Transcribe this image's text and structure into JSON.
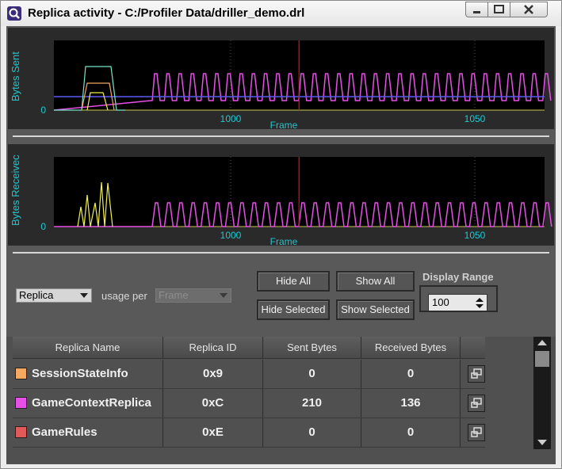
{
  "window": {
    "title": "Replica activity - C:/Profiler Data/driller_demo.drl",
    "buttons": [
      "minimize",
      "maximize",
      "close"
    ]
  },
  "colors": {
    "accent_cyan": "#1ec8d2",
    "frame_marker": "#d01818",
    "series_magenta": "#e650e6",
    "series_yellow": "#f0f050",
    "series_orange": "#f4a860",
    "series_cyan": "#78e6c8",
    "series_blue": "#5a5af0"
  },
  "graphs": {
    "sent": {
      "ylabel": "Bytes Sent",
      "xlabel": "Frame",
      "y_zero": "0",
      "ticks": [
        "1000",
        "1050"
      ]
    },
    "received": {
      "ylabel": "Bytes Receivec",
      "xlabel": "Frame",
      "y_zero": "0",
      "ticks": [
        "1000",
        "1050"
      ]
    }
  },
  "chart_data": [
    {
      "type": "line",
      "title": "",
      "xlabel": "Frame",
      "ylabel": "Bytes Sent",
      "x_ticks": [
        1000,
        1050
      ],
      "current_frame_marker": 1014,
      "series": [
        {
          "name": "GameContextReplica",
          "color": "#e650e6",
          "pattern": "periodic spikes from frame ~980"
        }
      ]
    },
    {
      "type": "line",
      "title": "",
      "xlabel": "Frame",
      "ylabel": "Bytes Receivec",
      "x_ticks": [
        1000,
        1050
      ],
      "current_frame_marker": 1014,
      "series": [
        {
          "name": "GameContextReplica",
          "color": "#e650e6",
          "pattern": "periodic spikes from frame ~980"
        }
      ]
    }
  ],
  "controls": {
    "replica_combo": "Replica",
    "usage_label": "usage per",
    "frame_combo": "Frame",
    "hide_all": "Hide All",
    "show_all": "Show All",
    "hide_selected": "Hide Selected",
    "show_selected": "Show Selected",
    "display_range_label": "Display Range",
    "display_range_value": "100"
  },
  "table": {
    "columns": [
      "Replica Name",
      "Replica ID",
      "Sent Bytes",
      "Received Bytes"
    ],
    "rows": [
      {
        "color": "#f4a860",
        "name": "SessionStateInfo",
        "id": "0x9",
        "sent": "0",
        "received": "0"
      },
      {
        "color": "#e650e6",
        "name": "GameContextReplica",
        "id": "0xC",
        "sent": "210",
        "received": "136"
      },
      {
        "color": "#e05a5a",
        "name": "GameRules",
        "id": "0xE",
        "sent": "0",
        "received": "0"
      }
    ]
  }
}
